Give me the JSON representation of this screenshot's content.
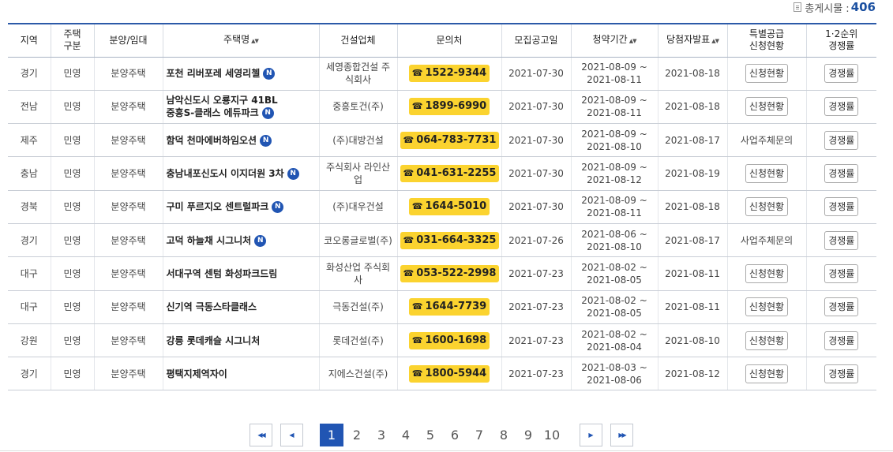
{
  "total": {
    "label": "총게시물 :",
    "count": "406"
  },
  "headers": [
    {
      "key": "region",
      "label": "지역"
    },
    {
      "key": "type",
      "label": "주택\n구분"
    },
    {
      "key": "sale",
      "label": "분양/임대"
    },
    {
      "key": "name",
      "label": "주택명",
      "sort": "▲▼"
    },
    {
      "key": "builder",
      "label": "건설업체"
    },
    {
      "key": "contact",
      "label": "문의처"
    },
    {
      "key": "notice",
      "label": "모집공고일"
    },
    {
      "key": "period",
      "label": "청약기간",
      "sort": "▲▼"
    },
    {
      "key": "winner",
      "label": "당첨자발표",
      "sort": "▲▼"
    },
    {
      "key": "special",
      "label": "특별공급\n신청현황"
    },
    {
      "key": "rank",
      "label": "1·2순위\n경쟁률"
    }
  ],
  "rows": [
    {
      "region": "경기",
      "type": "민영",
      "sale": "분양주택",
      "name": "포천 리버포레 세영리첼",
      "new": "N",
      "builder": "세영종합건설 주\n식회사",
      "phone": "1522-9344",
      "notice": "2021-07-30",
      "period": "2021-08-09 ~\n2021-08-11",
      "winner": "2021-08-18",
      "special": "신청현황",
      "special_btn": true,
      "rank": "경쟁률"
    },
    {
      "region": "전남",
      "type": "민영",
      "sale": "분양주택",
      "name": "남악신도시 오룡지구 41BL\n중흥S-클래스 에듀파크",
      "new": "N",
      "builder": "중흥토건(주)",
      "phone": "1899-6990",
      "notice": "2021-07-30",
      "period": "2021-08-09 ~\n2021-08-11",
      "winner": "2021-08-18",
      "special": "신청현황",
      "special_btn": true,
      "rank": "경쟁률"
    },
    {
      "region": "제주",
      "type": "민영",
      "sale": "분양주택",
      "name": "함덕 천마에버하임오션",
      "new": "N",
      "builder": "(주)대방건설",
      "phone": "064-783-7731",
      "notice": "2021-07-30",
      "period": "2021-08-09 ~\n2021-08-10",
      "winner": "2021-08-17",
      "special": "사업주체문의",
      "special_btn": false,
      "rank": "경쟁률"
    },
    {
      "region": "충남",
      "type": "민영",
      "sale": "분양주택",
      "name": "충남내포신도시 이지더원 3차",
      "new": "N",
      "builder": "주식회사 라인산\n업",
      "phone": "041-631-2255",
      "notice": "2021-07-30",
      "period": "2021-08-09 ~\n2021-08-12",
      "winner": "2021-08-19",
      "special": "신청현황",
      "special_btn": true,
      "rank": "경쟁률"
    },
    {
      "region": "경북",
      "type": "민영",
      "sale": "분양주택",
      "name": "구미 푸르지오 센트럴파크",
      "new": "N",
      "builder": "(주)대우건설",
      "phone": "1644-5010",
      "notice": "2021-07-30",
      "period": "2021-08-09 ~\n2021-08-11",
      "winner": "2021-08-18",
      "special": "신청현황",
      "special_btn": true,
      "rank": "경쟁률"
    },
    {
      "region": "경기",
      "type": "민영",
      "sale": "분양주택",
      "name": "고덕 하늘채 시그니처",
      "new": "N",
      "builder": "코오롱글로벌(주)",
      "phone": "031-664-3325",
      "notice": "2021-07-26",
      "period": "2021-08-06 ~\n2021-08-10",
      "winner": "2021-08-17",
      "special": "사업주체문의",
      "special_btn": false,
      "rank": "경쟁률"
    },
    {
      "region": "대구",
      "type": "민영",
      "sale": "분양주택",
      "name": "서대구역 센텀 화성파크드림",
      "new": "",
      "builder": "화성산업 주식회\n사",
      "phone": "053-522-2998",
      "notice": "2021-07-23",
      "period": "2021-08-02 ~\n2021-08-05",
      "winner": "2021-08-11",
      "special": "신청현황",
      "special_btn": true,
      "rank": "경쟁률"
    },
    {
      "region": "대구",
      "type": "민영",
      "sale": "분양주택",
      "name": "신기역 극동스타클래스",
      "new": "",
      "builder": "극동건설(주)",
      "phone": "1644-7739",
      "notice": "2021-07-23",
      "period": "2021-08-02 ~\n2021-08-05",
      "winner": "2021-08-11",
      "special": "신청현황",
      "special_btn": true,
      "rank": "경쟁률"
    },
    {
      "region": "강원",
      "type": "민영",
      "sale": "분양주택",
      "name": "강릉 롯데캐슬 시그니처",
      "new": "",
      "builder": "롯데건설(주)",
      "phone": "1600-1698",
      "notice": "2021-07-23",
      "period": "2021-08-02 ~\n2021-08-04",
      "winner": "2021-08-10",
      "special": "신청현황",
      "special_btn": true,
      "rank": "경쟁률"
    },
    {
      "region": "경기",
      "type": "민영",
      "sale": "분양주택",
      "name": "평택지제역자이",
      "new": "",
      "builder": "지에스건설(주)",
      "phone": "1800-5944",
      "notice": "2021-07-23",
      "period": "2021-08-03 ~\n2021-08-06",
      "winner": "2021-08-12",
      "special": "신청현황",
      "special_btn": true,
      "rank": "경쟁률"
    }
  ],
  "pagination": {
    "first": "◀◀",
    "prev": "◀",
    "next": "▶",
    "last": "▶▶",
    "pages": [
      "1",
      "2",
      "3",
      "4",
      "5",
      "6",
      "7",
      "8",
      "9",
      "10"
    ],
    "current": "1"
  },
  "colors": {
    "accent": "#2155b3",
    "phone_bg": "#fbd32f"
  },
  "icons": {
    "phone": "☎"
  }
}
